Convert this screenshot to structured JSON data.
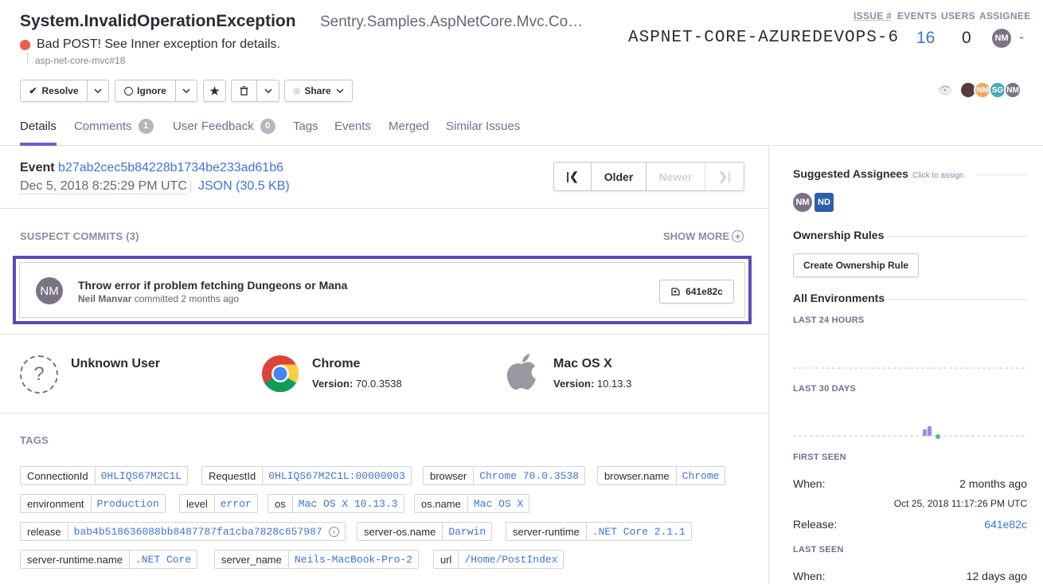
{
  "issue": {
    "title": "System.InvalidOperationException",
    "culprit": "Sentry.Samples.AspNetCore.Mvc.Co…",
    "message": "Bad POST! See Inner exception for details.",
    "project": "asp-net-core-mvc#18",
    "short_id": "ASPNET-CORE-AZUREDEVOPS-6",
    "events": "16",
    "users": "0",
    "assignee_initials": "NM",
    "status_color": "#f25a4a"
  },
  "stats_labels": {
    "issue": "ISSUE #",
    "events": "EVENTS",
    "users": "USERS",
    "assignee": "ASSIGNEE"
  },
  "toolbar": {
    "resolve": "Resolve",
    "ignore": "Ignore",
    "share": "Share"
  },
  "participants": [
    "NM",
    "SG",
    "NM"
  ],
  "tabs": [
    {
      "label": "Details"
    },
    {
      "label": "Comments",
      "count": "1"
    },
    {
      "label": "User Feedback",
      "count": "0"
    },
    {
      "label": "Tags"
    },
    {
      "label": "Events"
    },
    {
      "label": "Merged"
    },
    {
      "label": "Similar Issues"
    }
  ],
  "event": {
    "label": "Event",
    "id": "b27ab2cec5b84228b1734be233ad61b6",
    "date": "Dec 5, 2018 8:25:29 PM UTC",
    "json": "JSON (30.5 KB)"
  },
  "pager": {
    "older": "Older",
    "newer": "Newer"
  },
  "suspect_commits": {
    "title": "SUSPECT COMMITS (3)",
    "show_more": "SHOW MORE",
    "commit": {
      "avatar": "NM",
      "message": "Throw error if problem fetching Dungeons or Mana",
      "author": "Neil Manvar",
      "when": "committed 2 months ago",
      "sha": "641e82c"
    }
  },
  "context": {
    "user": {
      "title": "Unknown User"
    },
    "browser": {
      "title": "Chrome",
      "version_label": "Version:",
      "version": "70.0.3538"
    },
    "os": {
      "title": "Mac OS X",
      "version_label": "Version:",
      "version": "10.13.3"
    }
  },
  "tags": {
    "title": "TAGS",
    "items": [
      {
        "k": "ConnectionId",
        "v": "0HLIQS67M2C1L"
      },
      {
        "k": "RequestId",
        "v": "0HLIQS67M2C1L:00000003"
      },
      {
        "k": "browser",
        "v": "Chrome 70.0.3538"
      },
      {
        "k": "browser.name",
        "v": "Chrome"
      },
      {
        "k": "environment",
        "v": "Production"
      },
      {
        "k": "level",
        "v": "error"
      },
      {
        "k": "os",
        "v": "Mac OS X 10.13.3"
      },
      {
        "k": "os.name",
        "v": "Mac OS X"
      },
      {
        "k": "release",
        "v": "bab4b518636088bb8487787fa1cba7828c657987"
      },
      {
        "k": "server-os.name",
        "v": "Darwin"
      },
      {
        "k": "server-runtime",
        "v": ".NET Core 2.1.1"
      },
      {
        "k": "server-runtime.name",
        "v": ".NET Core"
      },
      {
        "k": "server_name",
        "v": "Neils-MacBook-Pro-2"
      },
      {
        "k": "url",
        "v": "/Home/PostIndex"
      }
    ]
  },
  "sidebar": {
    "suggested_title": "Suggested Assignees",
    "suggested_hint": "Click to assign",
    "suggested": [
      {
        "initials": "NM",
        "color": "#7b7383"
      },
      {
        "initials": "ND",
        "color": "#2f5fa8"
      }
    ],
    "ownership_title": "Ownership Rules",
    "create_rule": "Create Ownership Rule",
    "envs_title": "All Environments",
    "last24": "LAST 24 HOURS",
    "last30": "LAST 30 DAYS",
    "first_seen": "FIRST SEEN",
    "when_label": "When:",
    "first_when": "2 months ago",
    "first_date": "Oct 25, 2018 11:17:26 PM UTC",
    "release_label": "Release:",
    "release": "641e82c",
    "last_seen": "LAST SEEN",
    "last_when": "12 days ago"
  }
}
